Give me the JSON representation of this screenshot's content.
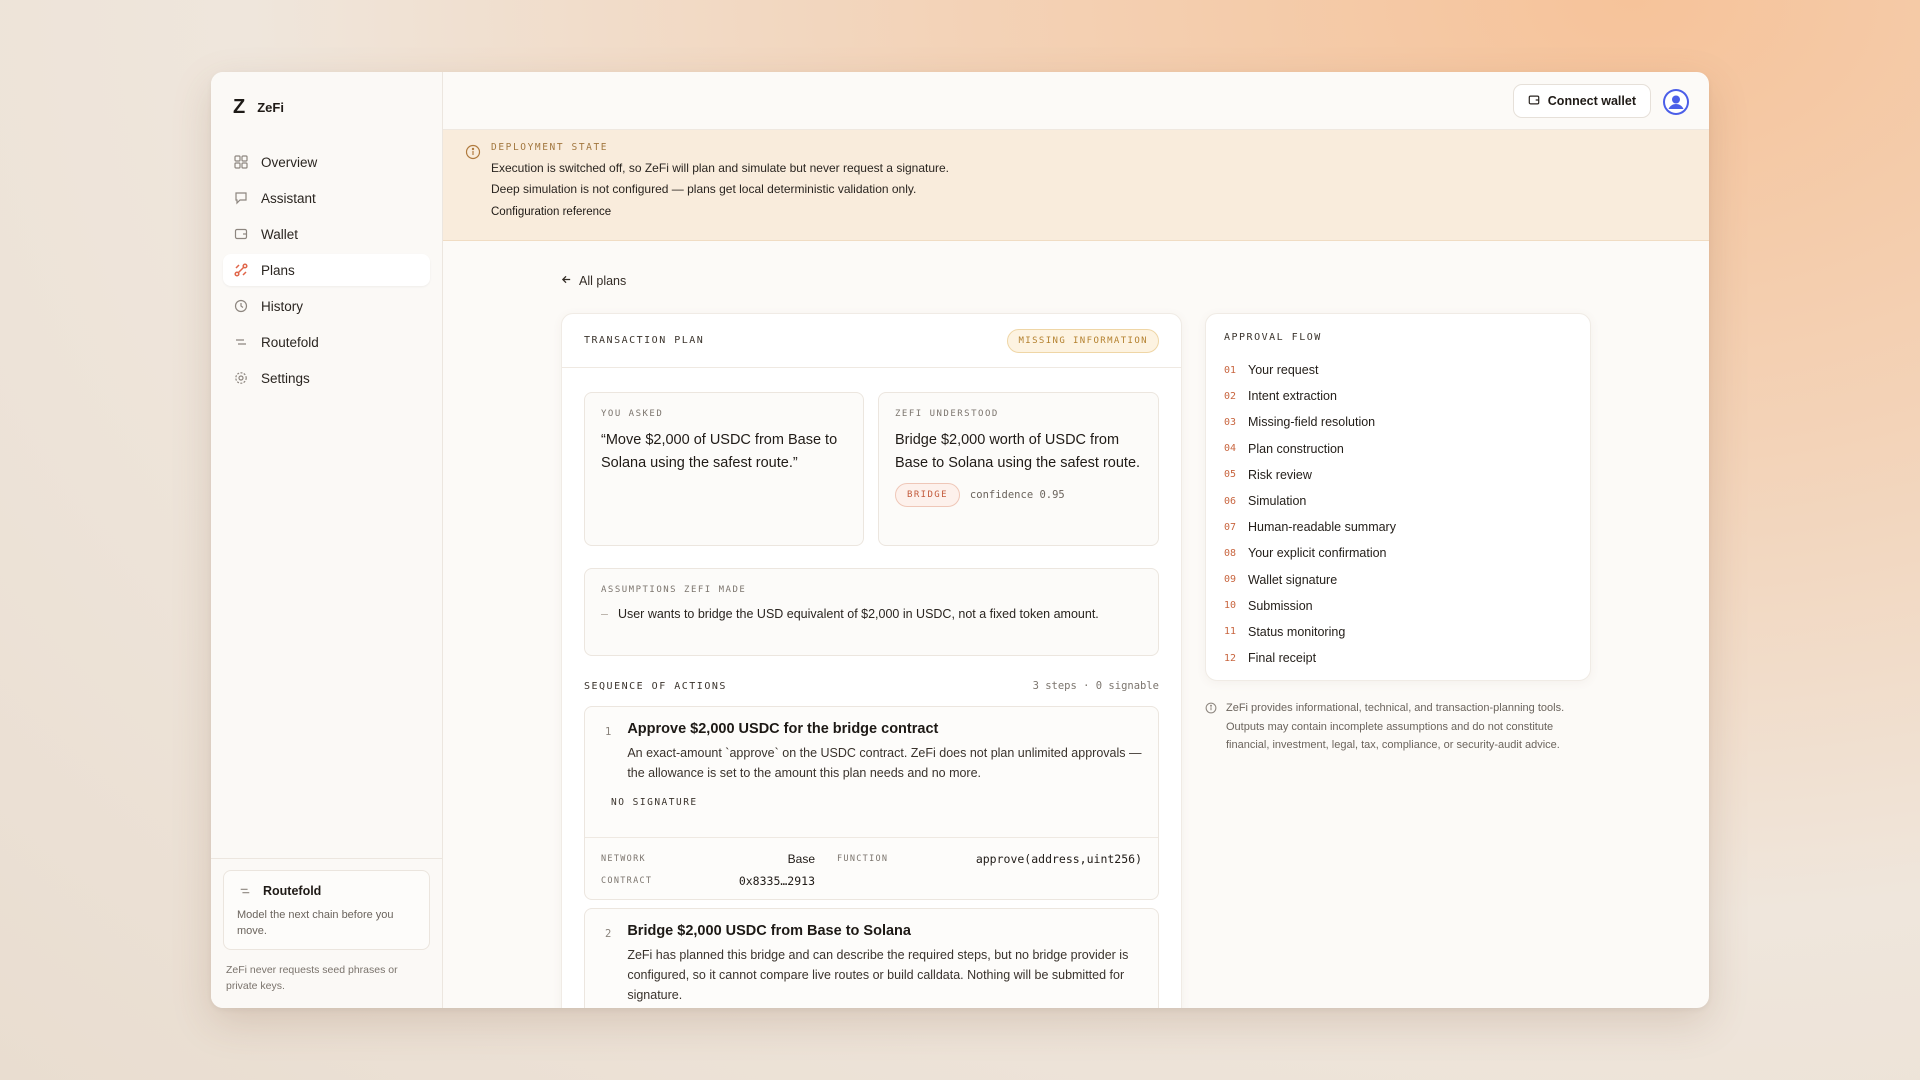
{
  "brand": {
    "mark": "Z",
    "name": "ZeFi"
  },
  "nav": [
    {
      "label": "Overview",
      "icon": "grid-icon"
    },
    {
      "label": "Assistant",
      "icon": "chat-icon"
    },
    {
      "label": "Wallet",
      "icon": "wallet-icon"
    },
    {
      "label": "Plans",
      "icon": "plans-icon",
      "active": true
    },
    {
      "label": "History",
      "icon": "history-icon"
    },
    {
      "label": "Routefold",
      "icon": "routefold-icon"
    },
    {
      "label": "Settings",
      "icon": "gear-icon"
    }
  ],
  "sidebar_card": {
    "title": "Routefold",
    "description": "Model the next chain before you move."
  },
  "sidebar_footer": "ZeFi never requests seed phrases or private keys.",
  "topbar": {
    "connect_label": "Connect wallet"
  },
  "banner": {
    "label": "DEPLOYMENT STATE",
    "line1": "Execution is switched off, so ZeFi will plan and simulate but never request a signature.",
    "line2": "Deep simulation is not configured — plans get local deterministic validation only.",
    "link": "Configuration reference"
  },
  "back_link": "All plans",
  "plan": {
    "title": "TRANSACTION PLAN",
    "status": "MISSING INFORMATION",
    "you_asked_label": "YOU ASKED",
    "you_asked": "“Move $2,000 of USDC from Base to Solana using the safest route.”",
    "understood_label": "ZEFI UNDERSTOOD",
    "understood": "Bridge $2,000 worth of USDC from Base to Solana using the safest route.",
    "intent_tag": "BRIDGE",
    "confidence": "confidence 0.95",
    "assumptions_label": "ASSUMPTIONS ZEFI MADE",
    "assumptions": [
      "User wants to bridge the USD equivalent of $2,000 in USDC, not a fixed token amount."
    ],
    "sequence_label": "SEQUENCE OF ACTIONS",
    "sequence_meta": "3 steps · 0 signable",
    "steps": [
      {
        "num": "1",
        "title": "Approve $2,000 USDC for the bridge contract",
        "desc": "An exact-amount `approve` on the USDC contract. ZeFi does not plan unlimited approvals — the allowance is set to the amount this plan needs and no more.",
        "signature": "NO SIGNATURE",
        "network_label": "NETWORK",
        "network": "Base",
        "function_label": "FUNCTION",
        "function": "approve(address,uint256)",
        "contract_label": "CONTRACT",
        "contract": "0x8335…2913"
      },
      {
        "num": "2",
        "title": "Bridge $2,000 USDC from Base to Solana",
        "desc": "ZeFi has planned this bridge and can describe the required steps, but no bridge provider is configured, so it cannot compare live routes or build calldata. Nothing will be submitted for signature."
      }
    ]
  },
  "approval_flow": {
    "label": "APPROVAL FLOW",
    "items": [
      {
        "num": "01",
        "label": "Your request"
      },
      {
        "num": "02",
        "label": "Intent extraction"
      },
      {
        "num": "03",
        "label": "Missing-field resolution"
      },
      {
        "num": "04",
        "label": "Plan construction"
      },
      {
        "num": "05",
        "label": "Risk review"
      },
      {
        "num": "06",
        "label": "Simulation"
      },
      {
        "num": "07",
        "label": "Human-readable summary"
      },
      {
        "num": "08",
        "label": "Your explicit confirmation"
      },
      {
        "num": "09",
        "label": "Wallet signature"
      },
      {
        "num": "10",
        "label": "Submission"
      },
      {
        "num": "11",
        "label": "Status monitoring"
      },
      {
        "num": "12",
        "label": "Final receipt"
      }
    ]
  },
  "disclaimer": "ZeFi provides informational, technical, and transaction-planning tools. Outputs may contain incomplete assumptions and do not constitute financial, investment, legal, tax, compliance, or security-audit advice.",
  "colors": {
    "accent": "#e0664a",
    "avatar": "#4b5ee8",
    "banner_bg": "#f9ecdc",
    "warning": "#b4812f"
  }
}
